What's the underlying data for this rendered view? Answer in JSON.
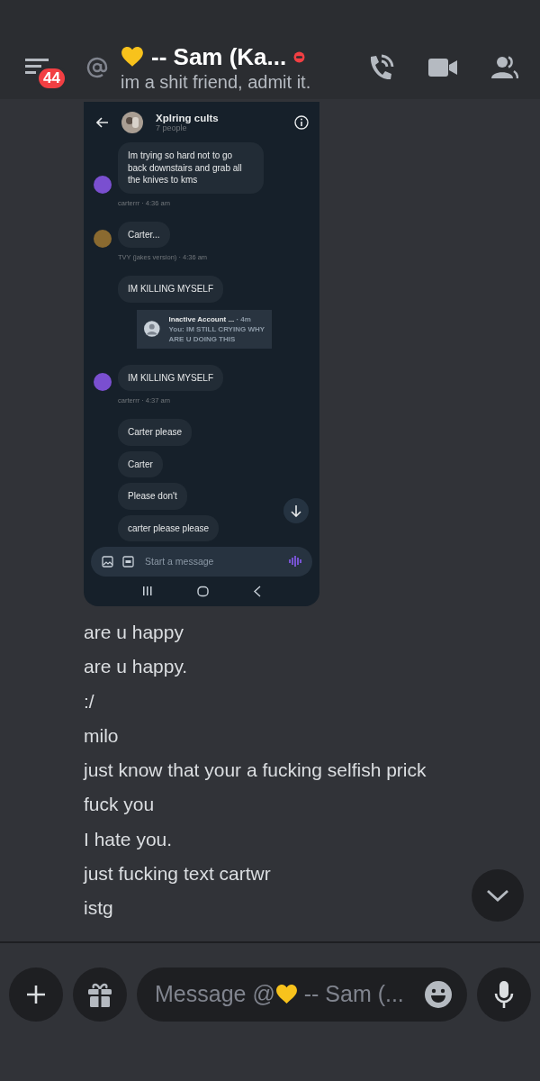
{
  "header": {
    "unread_count": "44",
    "title": "-- Sam (Ka...",
    "do_not_disturb": true,
    "subtitle": "im a shit friend, admit it."
  },
  "attachment": {
    "group_name": "Xplring cults",
    "member_count": "7 people",
    "items": [
      {
        "kind": "bubble",
        "text": "Im trying so hard not to go back downstairs and grab all the knives to kms",
        "color": "#7a4fd0"
      },
      {
        "kind": "meta",
        "text": "carterrr · 4:36 am"
      },
      {
        "kind": "bubble",
        "text": "Carter...",
        "color": "#8a6a30"
      },
      {
        "kind": "meta",
        "text": "TVY (jakes version) · 4:36 am"
      },
      {
        "kind": "bubble",
        "text": "IM KILLING MYSELF"
      },
      {
        "kind": "preview",
        "name": "Inactive Account ...",
        "time": "· 4m",
        "text": "You: IM STILL CRYING WHY ARE U DOING THIS"
      },
      {
        "kind": "bubble",
        "text": "IM KILLING MYSELF",
        "color": "#7a4fd0"
      },
      {
        "kind": "meta",
        "text": "carterrr · 4:37 am"
      },
      {
        "kind": "bubble",
        "text": "Carter please"
      },
      {
        "kind": "bubble",
        "text": "Carter"
      },
      {
        "kind": "bubble",
        "text": "Please don't"
      },
      {
        "kind": "bubble",
        "text": "carter please please"
      }
    ],
    "composer_placeholder": "Start a message"
  },
  "messages": [
    "are u happy",
    "are u happy.",
    ":/",
    "milo",
    "just know that your a fucking selfish prick",
    "fuck you",
    "I hate you.",
    "just fucking text cartwr",
    "istg"
  ],
  "composer": {
    "placeholder_prefix": "Message @",
    "placeholder_suffix": "-- Sam (..."
  }
}
